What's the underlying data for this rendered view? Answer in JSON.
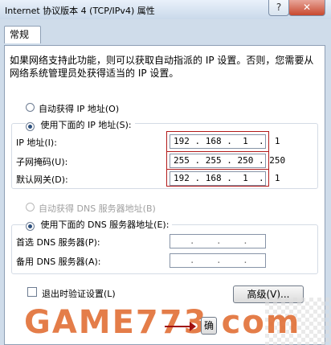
{
  "window": {
    "title": "Internet 协议版本 4 (TCP/IPv4) 属性",
    "help_label": "?",
    "close_label": "✕"
  },
  "tabs": [
    {
      "label": "常规"
    }
  ],
  "general": {
    "description": "如果网络支持此功能，则可以获取自动指派的 IP 设置。否则，您需要从网络系统管理员处获得适当的 IP 设置。",
    "ip_auto_label": "自动获得 IP 地址(O)",
    "ip_manual_label": "使用下面的 IP 地址(S):",
    "ip_address_label": "IP 地址(I):",
    "ip_address_value": "192 . 168 .  1  .  1",
    "subnet_label": "子网掩码(U):",
    "subnet_value": "255 . 255 . 250 . 250",
    "gateway_label": "默认网关(D):",
    "gateway_value": "192 . 168 .  1  .  1",
    "dns_auto_label": "自动获得 DNS 服务器地址(B)",
    "dns_manual_label": "使用下面的 DNS 服务器地址(E):",
    "dns_preferred_label": "首选 DNS 服务器(P):",
    "dns_preferred_value": "   .    .    .   ",
    "dns_alternate_label": "备用 DNS 服务器(A):",
    "dns_alternate_value": "   .    .    .   ",
    "validate_label": "退出时验证设置(L)",
    "advanced_label": "高级(V)...",
    "ok_label": "确"
  },
  "watermark": {
    "text": "GAME773.com"
  }
}
